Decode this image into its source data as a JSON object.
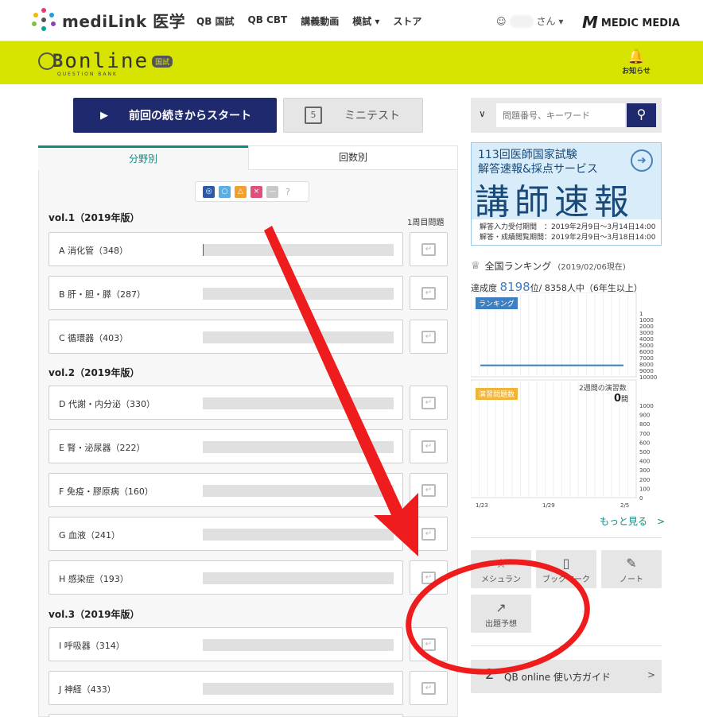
{
  "header": {
    "brand": "mediLink 医学",
    "nav": [
      "QB 国試",
      "QB CBT",
      "講義動画",
      "模試 ▾",
      "ストア"
    ],
    "user_suffix": "さん ▾",
    "publisher": "MEDIC MEDIA"
  },
  "subheader": {
    "logo_b": "B",
    "logo_online": "online",
    "logo_badge": "国試",
    "logo_sub": "QUESTION BANK",
    "notify_label": "お知らせ"
  },
  "actions": {
    "start_label": "前回の続きからスタート",
    "mini_label": "ミニテスト"
  },
  "tabs": [
    "分野別",
    "回数別"
  ],
  "filters": [
    "◎",
    "○",
    "△",
    "×",
    "—",
    "?"
  ],
  "filter_colors": [
    "#2d5aa5",
    "#5aaee0",
    "#f0a030",
    "#e0507a",
    "#c8c8c8"
  ],
  "round_header": "1周目問題",
  "volumes": [
    {
      "title": "vol.1（2019年版）",
      "subjects": [
        "A 消化管（348）",
        "B 肝・胆・膵（287）",
        "C 循環器（403）"
      ]
    },
    {
      "title": "vol.2（2019年版）",
      "subjects": [
        "D 代謝・内分泌（330）",
        "E 腎・泌尿器（222）",
        "F 免疫・膠原病（160）",
        "G 血液（241）",
        "H 感染症（193）"
      ]
    },
    {
      "title": "vol.3（2019年版）",
      "subjects": [
        "I 呼吸器（314）",
        "J 神経（433）"
      ]
    }
  ],
  "progress": {
    "A": 0.004
  },
  "search": {
    "placeholder": "問題番号、キーワード"
  },
  "banner": {
    "line1": "113回医師国家試験",
    "line2": "解答速報&採点サービス",
    "big": "講師速報",
    "foot1": "解答入力受付期間　：2019年2月9日〜3月14日14:00",
    "foot2": "解答・成績閲覧期間：2019年2月9日〜3月18日14:00"
  },
  "ranking": {
    "title": "全国ランキング",
    "date": "(2019/02/06現在)",
    "stat_prefix": "達成度 ",
    "rank": "8198",
    "stat_suffix": "位/ 8358人中（6年生以上）",
    "badge1": "ランキング",
    "badge2": "演習問題数",
    "weeks_label": "2週間の演習数",
    "count": "0",
    "count_unit": "問",
    "more": "もっと見る　>"
  },
  "chart_data": [
    {
      "type": "line",
      "title": "ランキング",
      "x": [
        "1/23",
        "1/29",
        "2/5"
      ],
      "y_ticks": [
        "1",
        "1000",
        "2000",
        "3000",
        "4000",
        "5000",
        "6000",
        "7000",
        "8000",
        "9000",
        "10000"
      ],
      "y_reversed": true,
      "series": [
        {
          "values": [
            8198,
            8198,
            8198
          ]
        }
      ]
    },
    {
      "type": "bar",
      "title": "演習問題数",
      "x": [
        "1/23",
        "1/29",
        "2/5"
      ],
      "y_ticks": [
        "1000",
        "900",
        "800",
        "700",
        "600",
        "500",
        "400",
        "300",
        "200",
        "100",
        "0"
      ],
      "series": [
        {
          "values": [
            0,
            0,
            0
          ]
        }
      ]
    }
  ],
  "tools": [
    "メシュラン",
    "ブックマーク",
    "ノート",
    "出題予想"
  ],
  "guide": {
    "num": "2",
    "label": "QB online 使い方ガイド",
    "chev": ">"
  }
}
